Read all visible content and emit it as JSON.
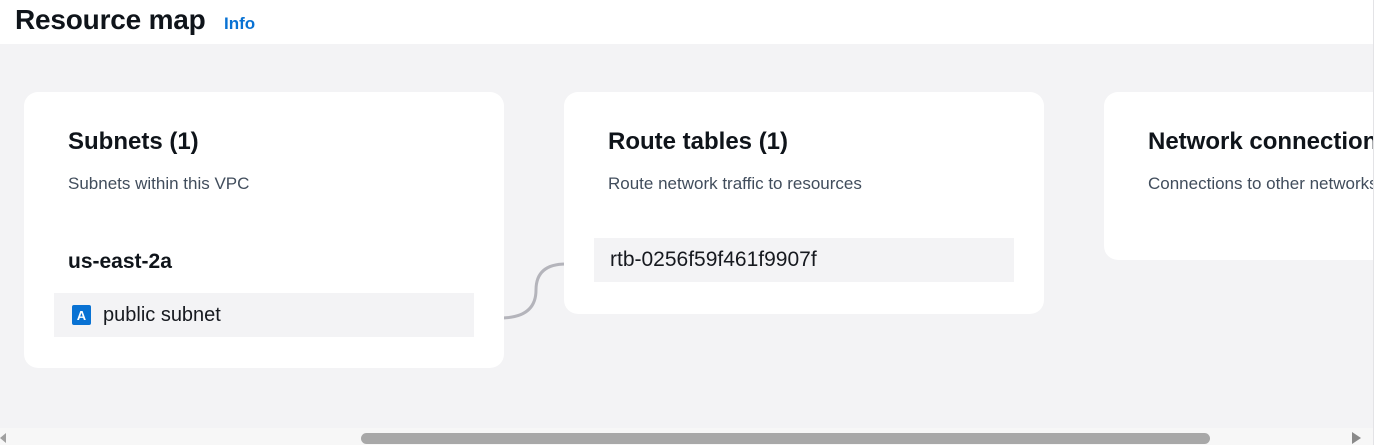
{
  "header": {
    "title": "Resource map",
    "info_label": "Info"
  },
  "cards": {
    "subnets": {
      "title": "Subnets (1)",
      "description": "Subnets within this VPC",
      "az": "us-east-2a",
      "items": [
        {
          "badge": "A",
          "label": "public subnet"
        }
      ]
    },
    "route_tables": {
      "title": "Route tables (1)",
      "description": "Route network traffic to resources",
      "items": [
        {
          "label": "rtb-0256f59f461f9907f"
        }
      ]
    },
    "network_connections": {
      "title": "Network connections",
      "description": "Connections to other networks"
    }
  },
  "colors": {
    "link": "#0972d3",
    "badge": "#0972d3",
    "canvas": "#f3f3f5",
    "connector": "#b4b4bb"
  },
  "icons": {
    "subnet_badge": "az-badge-icon",
    "scroll_left": "scroll-left-arrow-icon",
    "scroll_right": "scroll-right-arrow-icon"
  }
}
